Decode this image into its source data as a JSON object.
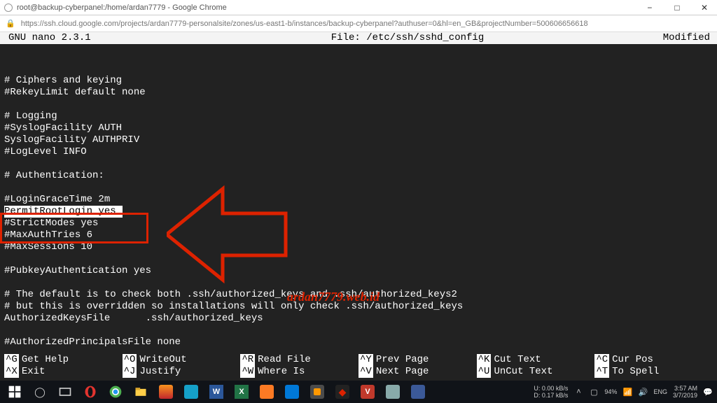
{
  "browser": {
    "title": "root@backup-cyberpanel:/home/ardan7779 - Google Chrome",
    "url": "https://ssh.cloud.google.com/projects/ardan7779-personalsite/zones/us-east1-b/instances/backup-cyberpanel?authuser=0&hl=en_GB&projectNumber=500606656618"
  },
  "nano": {
    "app_version": "  GNU nano 2.3.1",
    "file_label": "File: /etc/ssh/sshd_config",
    "status": "Modified ",
    "lines": [
      "",
      "# Ciphers and keying",
      "#RekeyLimit default none",
      "",
      "# Logging",
      "#SyslogFacility AUTH",
      "SyslogFacility AUTHPRIV",
      "#LogLevel INFO",
      "",
      "# Authentication:",
      "",
      "#LoginGraceTime 2m",
      "",
      "#StrictModes yes",
      "#MaxAuthTries 6",
      "#MaxSessions 10",
      "",
      "#PubkeyAuthentication yes",
      "",
      "# The default is to check both .ssh/authorized_keys and .ssh/authorized_keys2",
      "# but this is overridden so installations will only check .ssh/authorized_keys",
      "AuthorizedKeysFile      .ssh/authorized_keys",
      "",
      "#AuthorizedPrincipalsFile none"
    ],
    "highlighted_line": "PermitRootLogin yes",
    "shortcuts": {
      "r1": [
        {
          "key": "^G",
          "label": "Get Help"
        },
        {
          "key": "^O",
          "label": "WriteOut"
        },
        {
          "key": "^R",
          "label": "Read File"
        },
        {
          "key": "^Y",
          "label": "Prev Page"
        },
        {
          "key": "^K",
          "label": "Cut Text"
        },
        {
          "key": "^C",
          "label": "Cur Pos"
        }
      ],
      "r2": [
        {
          "key": "^X",
          "label": "Exit"
        },
        {
          "key": "^J",
          "label": "Justify"
        },
        {
          "key": "^W",
          "label": "Where Is"
        },
        {
          "key": "^V",
          "label": "Next Page"
        },
        {
          "key": "^U",
          "label": "UnCut Text"
        },
        {
          "key": "^T",
          "label": "To Spell"
        }
      ]
    }
  },
  "annotation": {
    "watermark": "ardan7779.web.id"
  },
  "taskbar": {
    "tray_user": "U:",
    "tray_down": "D:",
    "tray_up_val": "0.00 kB/s",
    "tray_dn_val": "0.17 kB/s",
    "battery": "94%",
    "lang1": "ENG",
    "time": "3:57 AM",
    "date": "3/7/2019"
  }
}
